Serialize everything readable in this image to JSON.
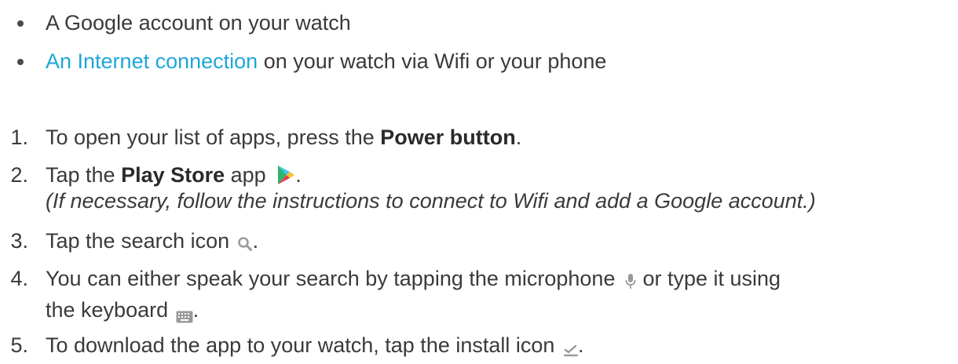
{
  "requirements": [
    {
      "text": "A Google account on your watch"
    },
    {
      "link_text": "An Internet connection",
      "text": " on your watch via Wifi or your phone"
    }
  ],
  "steps": [
    {
      "num": "1.",
      "pre": "To open your list of apps, press the ",
      "bold": "Power button",
      "post": "."
    },
    {
      "num": "2.",
      "pre": "Tap the ",
      "bold": "Play Store",
      "post": " app",
      "end": ".",
      "note": "(If necessary, follow the instructions to connect to Wifi and add a Google account.)",
      "icon": "play-store-icon"
    },
    {
      "num": "3.",
      "pre": "Tap the search icon",
      "end": ".",
      "icon": "search-icon"
    },
    {
      "num": "4.",
      "pre": "You can either speak your search by tapping the microphone",
      "mid": " or type it using",
      "line2_pre": "the keyboard",
      "end": ".",
      "icons": [
        "microphone-icon",
        "keyboard-icon"
      ]
    },
    {
      "num": "5.",
      "pre": "To download the app to your watch, tap the install icon",
      "end": ".",
      "icon": "install-icon"
    }
  ],
  "colors": {
    "text": "#3a3a3a",
    "link": "#1ea7d8",
    "icon_gray": "#9a9a9a"
  }
}
